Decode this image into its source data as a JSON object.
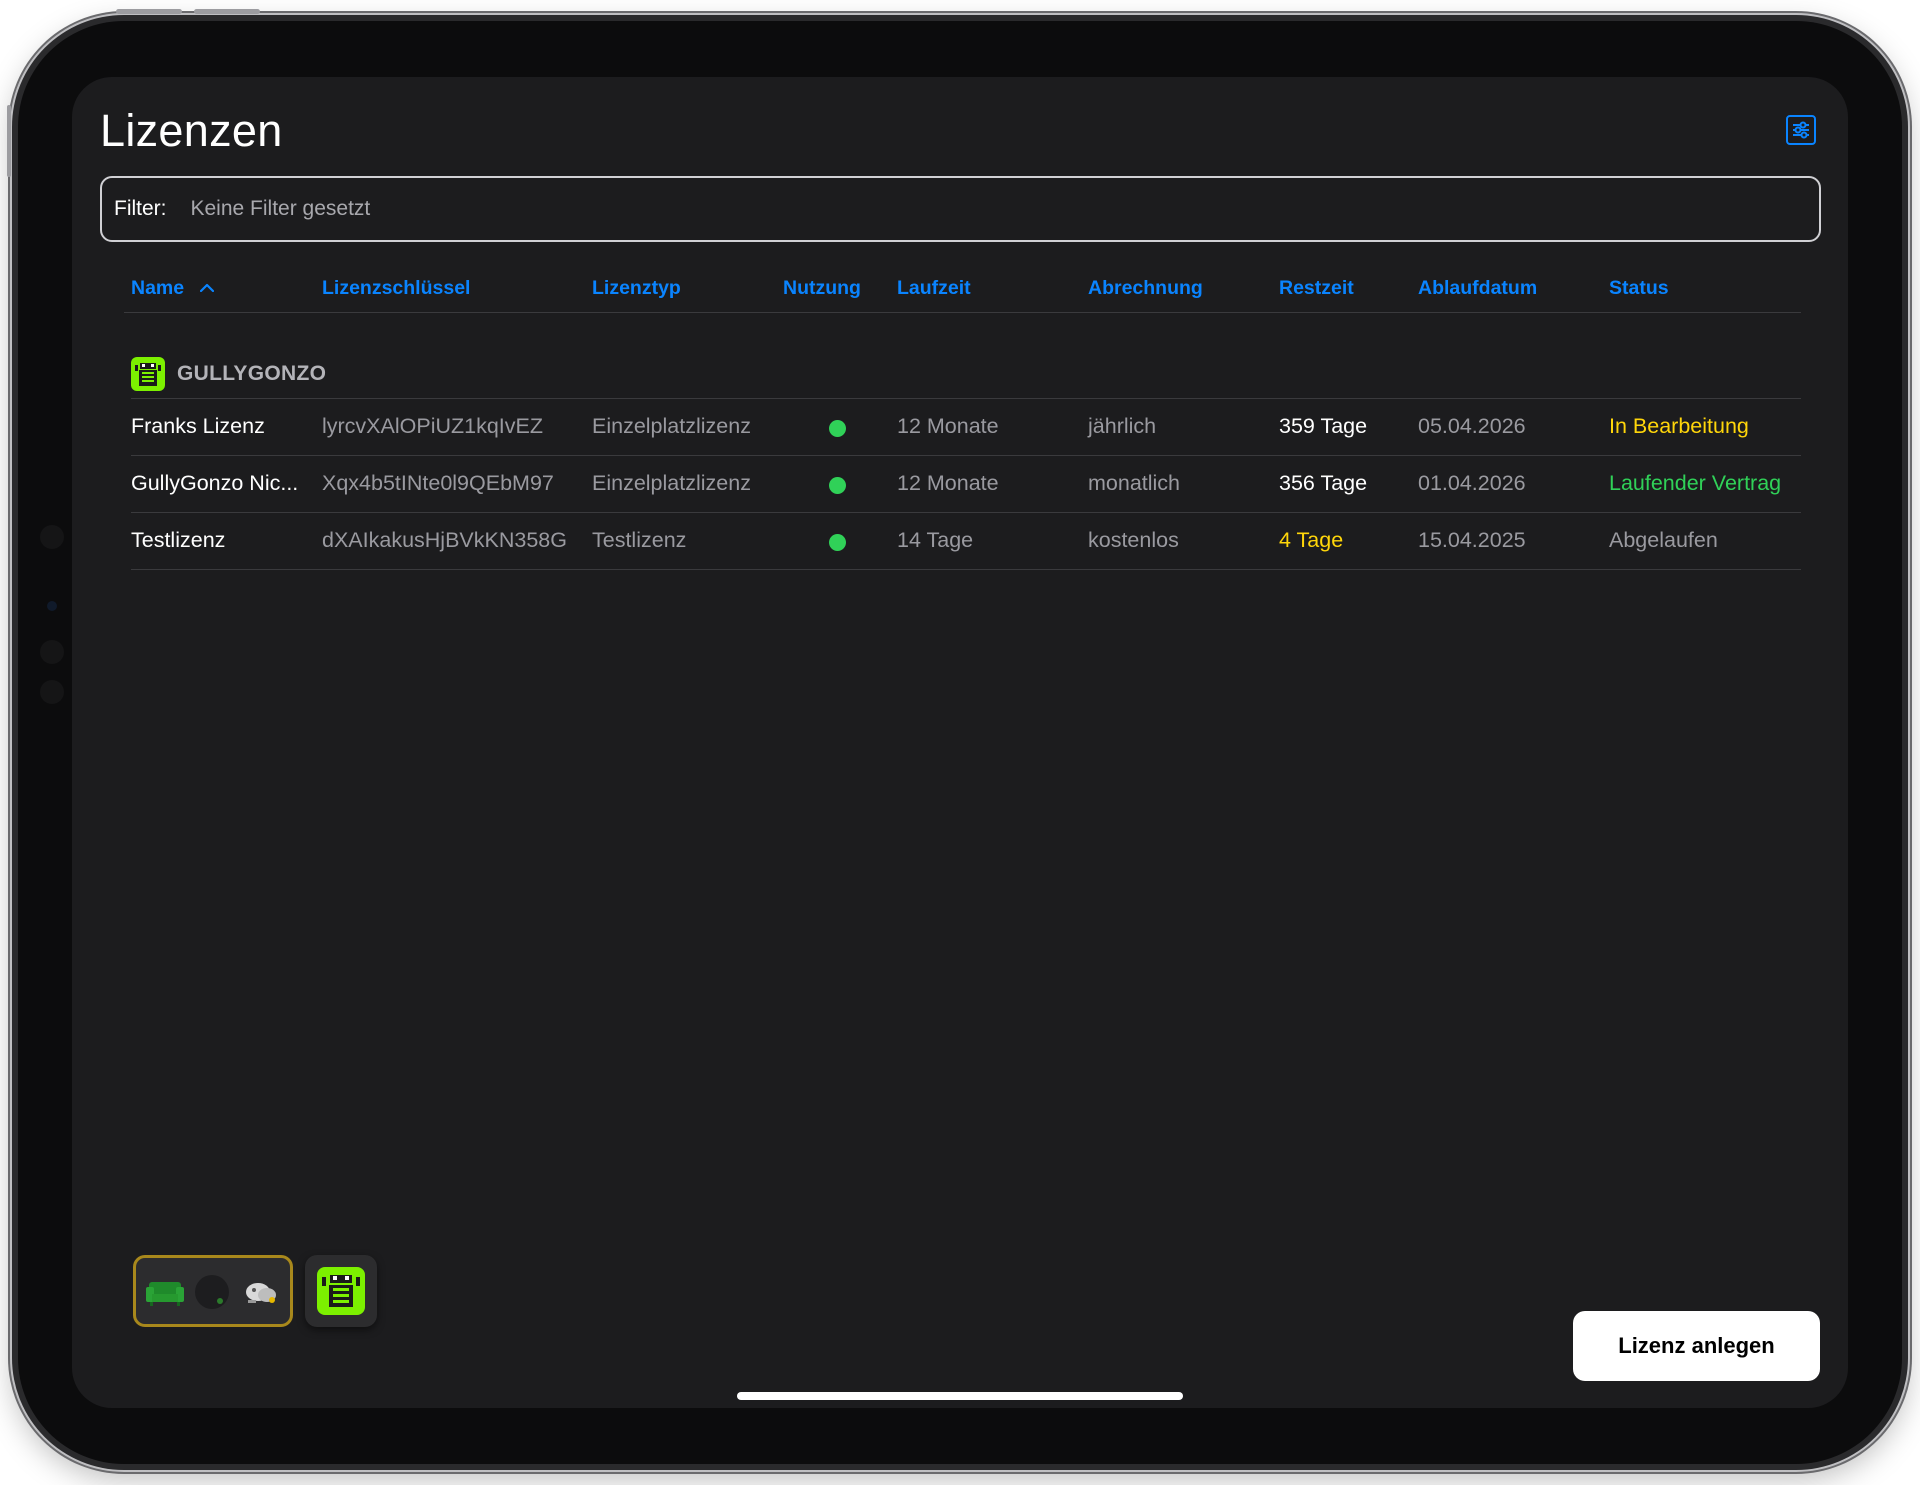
{
  "page": {
    "title": "Lizenzen",
    "filter": {
      "label": "Filter:",
      "value": "Keine Filter gesetzt"
    }
  },
  "table": {
    "columns": [
      "Name",
      "Lizenzschlüssel",
      "Lizenztyp",
      "Nutzung",
      "Laufzeit",
      "Abrechnung",
      "Restzeit",
      "Ablaufdatum",
      "Status"
    ],
    "sort": {
      "column": "Name",
      "direction": "ascending"
    },
    "group": "GULLYGONZO",
    "rows": [
      {
        "name": "Franks Lizenz",
        "key": "lyrcvXAlOPiUZ1kqIvEZ",
        "type": "Einzelplatzlizenz",
        "usage": "active",
        "duration": "12 Monate",
        "billing": "jährlich",
        "remaining": "359 Tage",
        "expiry": "05.04.2026",
        "status": "In Bearbeitung"
      },
      {
        "name": "GullyGonzo Nic...",
        "key": "Xqx4b5tINte0l9QEbM97",
        "type": "Einzelplatzlizenz",
        "usage": "active",
        "duration": "12 Monate",
        "billing": "monatlich",
        "remaining": "356 Tage",
        "expiry": "01.04.2026",
        "status": "Laufender Vertrag"
      },
      {
        "name": "Testlizenz",
        "key": "dXAIkakusHjBVkKN358G",
        "type": "Testlizenz",
        "usage": "active",
        "duration": "14 Tage",
        "billing": "kostenlos",
        "remaining": "4 Tage",
        "expiry": "15.04.2025",
        "status": "Abgelaufen"
      }
    ]
  },
  "actions": {
    "create_label": "Lizenz anlegen"
  },
  "dock": {
    "items": [
      "app-group-folder-icon",
      "gullygonzo-app-icon"
    ]
  },
  "colors": {
    "accent": "#0a84ff",
    "usage_active": "#30d158",
    "status_in_progress": "#ffd60a",
    "status_running": "#30d158",
    "status_expired": "#9a9aa0",
    "remaining_warning": "#ffd60a"
  }
}
